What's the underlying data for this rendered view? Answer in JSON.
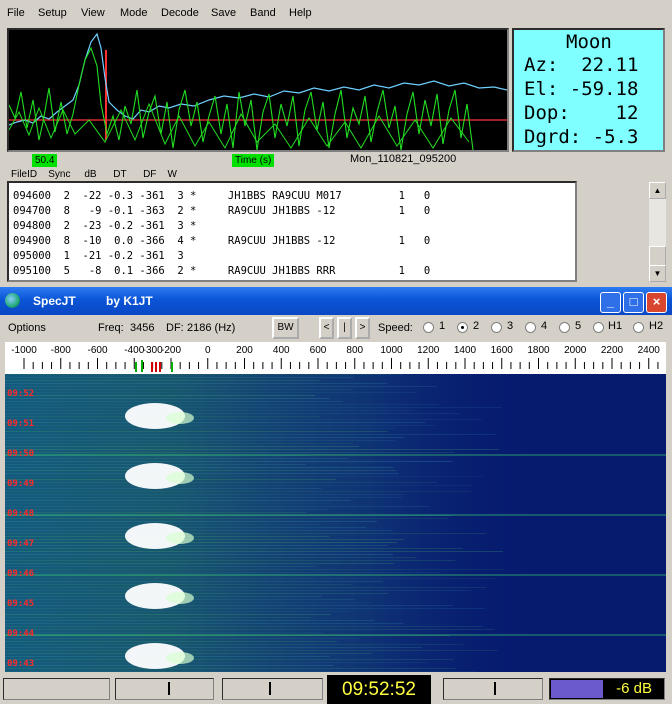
{
  "menu": [
    "File",
    "Setup",
    "View",
    "Mode",
    "Decode",
    "Save",
    "Band",
    "Help"
  ],
  "moon": {
    "title": "Moon",
    "az": "Az:  22.11",
    "el": "El: -59.18",
    "dop": "Dop:    12",
    "dgrd": "Dgrd: -5.3"
  },
  "plot": {
    "left_label": "50.4",
    "time_label": "Time (s)",
    "datestamp": "Mon_110821_095200"
  },
  "decode_headers": "FileID    Sync     dB      DT      DF    W",
  "decodes": [
    "094600  2  -22 -0.3 -361  3 *     JH1BBS RA9CUU M017         1   0",
    "094700  8   -9 -0.1 -363  2 *     RA9CUU JH1BBS -12          1   0",
    "094800  2  -23 -0.2 -361  3 *",
    "094900  8  -10  0.0 -366  4 *     RA9CUU JH1BBS -12          1   0",
    "095000  1  -21 -0.2 -361  3",
    "095100  5   -8  0.1 -366  2 *     RA9CUU JH1BBS RRR          1   0"
  ],
  "spec": {
    "title": "SpecJT",
    "subtitle": "by K1JT",
    "options_label": "Options",
    "freq_label": "Freq:",
    "freq_value": "3456",
    "df_label": "DF:",
    "df_value": "2186 (Hz)",
    "bw_label": "BW",
    "nav": [
      "<",
      "|",
      ">"
    ],
    "speed_label": "Speed:",
    "speed_options": [
      "1",
      "2",
      "3",
      "4",
      "5",
      "H1",
      "H2"
    ],
    "speed_selected": "2",
    "freq_ticks": [
      "-1000",
      "-800",
      "-600",
      "-400",
      "-300",
      "-200",
      "0",
      "200",
      "400",
      "600",
      "800",
      "1000",
      "1200",
      "1400",
      "1600",
      "1800",
      "2000",
      "2200",
      "2400"
    ],
    "time_labels": [
      "09:52",
      "09:51",
      "09:50",
      "09:49",
      "09:48",
      "09:47",
      "09:46",
      "09:45",
      "09:44",
      "09:43"
    ]
  },
  "status": {
    "clock": "09:52:52",
    "db": "-6 dB"
  },
  "colors": {
    "moon_bg": "#7fffff",
    "plot_green": "#22dd22",
    "plot_cyan": "#6fd0ff",
    "plot_red": "#ff3030",
    "waterfall_bg": "#061a6e",
    "clock_text": "#ffff40"
  },
  "icons": [
    "globe-icon",
    "minimize-icon",
    "maximize-icon",
    "close-icon"
  ]
}
